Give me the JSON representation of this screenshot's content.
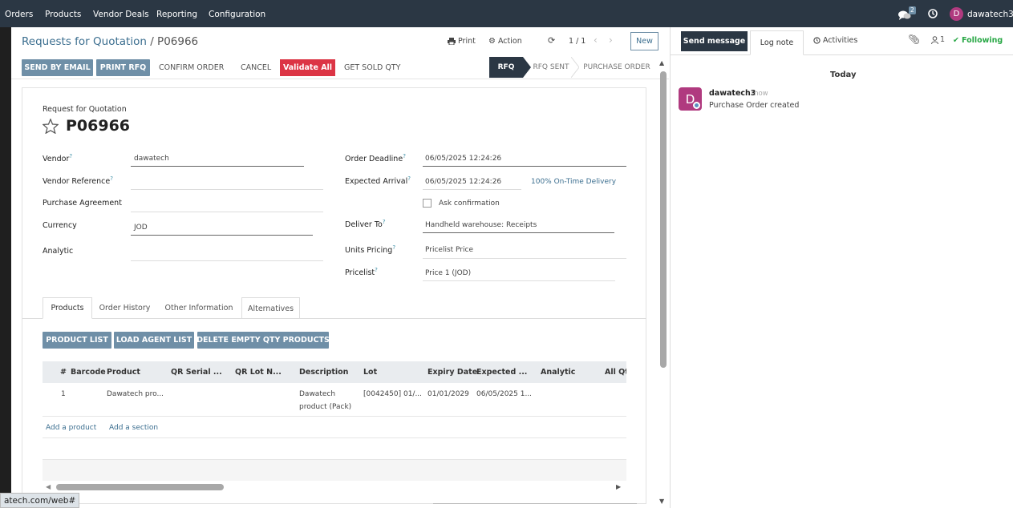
{
  "topnav": {
    "items": [
      "Orders",
      "Products",
      "Vendor Deals",
      "Reporting",
      "Configuration"
    ],
    "messages_count": "2",
    "user_initial": "D",
    "user_name": "dawatech3"
  },
  "breadcrumb": {
    "parent": "Requests for Quotation",
    "separator": "/",
    "current": "P06966"
  },
  "controlpanel": {
    "print": "Print",
    "action": "Action",
    "pager": "1 / 1",
    "new": "New"
  },
  "actions": {
    "send_by_email": "SEND BY EMAIL",
    "print_rfq": "PRINT RFQ",
    "confirm_order": "CONFIRM ORDER",
    "cancel": "CANCEL",
    "validate_all": "Validate All",
    "get_sold_qty": "GET SOLD QTY"
  },
  "statusbar": {
    "stages": [
      "RFQ",
      "RFQ SENT",
      "PURCHASE ORDER"
    ],
    "active": "RFQ"
  },
  "form": {
    "subtitle": "Request for Quotation",
    "name": "P06966",
    "vendor_label": "Vendor",
    "vendor_value": "dawatech",
    "vendor_ref_label": "Vendor Reference",
    "purchase_agreement_label": "Purchase Agreement",
    "currency_label": "Currency",
    "currency_value": "JOD",
    "analytic_label": "Analytic",
    "order_deadline_label": "Order Deadline",
    "order_deadline_value": "06/05/2025 12:24:26",
    "expected_arrival_label": "Expected Arrival",
    "expected_arrival_value": "06/05/2025 12:24:26",
    "on_time_delivery": "100% On-Time Delivery",
    "ask_confirmation_label": "Ask confirmation",
    "deliver_to_label": "Deliver To",
    "deliver_to_value": "Handheld warehouse: Receipts",
    "units_pricing_label": "Units Pricing",
    "units_pricing_value": "Pricelist Price",
    "pricelist_label": "Pricelist",
    "pricelist_value": "Price 1 (JOD)",
    "help_marker": "?"
  },
  "tabs": [
    "Products",
    "Order History",
    "Other Information",
    "Alternatives"
  ],
  "product_buttons": {
    "product_list": "PRODUCT LIST",
    "load_agent_list": "LOAD AGENT LIST",
    "delete_empty": "DELETE EMPTY QTY PRODUCTS"
  },
  "table": {
    "headers": [
      "#",
      "Barcode",
      "Product",
      "QR Serial ...",
      "QR Lot N...",
      "Description",
      "Lot",
      "Expiry Date",
      "Expected ...",
      "Analytic",
      "All Qt"
    ],
    "rows": [
      {
        "num": "1",
        "barcode": "",
        "product": "Dawatech pro...",
        "qr_serial": "",
        "qr_lot": "",
        "description_line1": "Dawatech",
        "description_line2": "product (Pack)",
        "lot": "[0042450] 01/...",
        "expiry": "01/01/2029",
        "expected": "06/05/2025 1...",
        "analytic": ""
      }
    ],
    "add_product": "Add a product",
    "add_section": "Add a section"
  },
  "chatter": {
    "send_message": "Send message",
    "log_note": "Log note",
    "activities": "Activities",
    "followers_count": "1",
    "following": "Following",
    "date_separator": "Today",
    "message": {
      "avatar_initial": "D",
      "author": "dawatech3",
      "time": "now",
      "body": "Purchase Order created"
    }
  },
  "statusbar_url": "atech.com/web#",
  "colors": {
    "navbar": "#2b3744",
    "primary_button": "#6f8fa7",
    "danger": "#dc3545",
    "active_stage": "#2b3744",
    "following_green": "#28a745",
    "avatar": "#b03a7f",
    "link": "#3b6e8f"
  }
}
